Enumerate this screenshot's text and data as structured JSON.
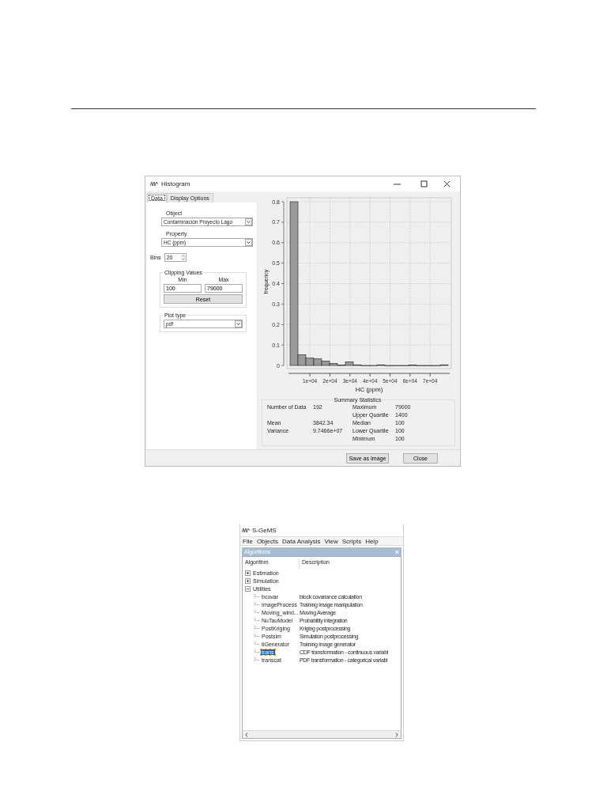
{
  "histogram_window": {
    "title": "Histogram",
    "tabs": [
      {
        "label": "Data",
        "selected": true
      },
      {
        "label": "Display Options",
        "selected": false
      }
    ],
    "object": {
      "label": "Object",
      "value": "Contaminación Proyecto Lago"
    },
    "property": {
      "label": "Property",
      "value": "HC (ppm)"
    },
    "bins": {
      "label": "Bins",
      "value": "20"
    },
    "clipping": {
      "title": "Clipping Values",
      "min_label": "Min",
      "min_value": "100",
      "max_label": "Max",
      "max_value": "79000",
      "reset_button": "Reset"
    },
    "plot_type": {
      "title": "Plot type",
      "value": "pdf"
    },
    "chart_data": {
      "type": "bar",
      "grid": true,
      "xlabel": "HC (ppm)",
      "ylabel": "frequency",
      "x": [
        2073,
        6018,
        9963,
        13908,
        17853,
        21798,
        25743,
        29688,
        33633,
        37578,
        41523,
        45468,
        49413,
        53358,
        57303,
        61248,
        65193,
        69138,
        73083,
        77028
      ],
      "values": [
        0.8,
        0.052,
        0.036,
        0.032,
        0.022,
        0.01,
        0.002,
        0.018,
        0.003,
        0,
        0,
        0.003,
        0,
        0,
        0,
        0.002,
        0,
        0,
        0,
        0.003
      ],
      "xlim": [
        100,
        79000
      ],
      "ylim": [
        0,
        0.8
      ],
      "xticks": [
        {
          "value": 10000,
          "label": "1e+04"
        },
        {
          "value": 20000,
          "label": "2e+04"
        },
        {
          "value": 30000,
          "label": "3e+04"
        },
        {
          "value": 40000,
          "label": "4e+04"
        },
        {
          "value": 50000,
          "label": "5e+04"
        },
        {
          "value": 60000,
          "label": "6e+04"
        },
        {
          "value": 70000,
          "label": "7e+04"
        }
      ],
      "yticks": [
        0,
        0.1,
        0.2,
        0.3,
        0.4,
        0.5,
        0.6,
        0.7,
        0.8
      ]
    },
    "summary": {
      "title": "Summary Statistics",
      "left": [
        {
          "label": "Number of Data",
          "value": "192"
        },
        {
          "label": "Mean",
          "value": "3842.34"
        },
        {
          "label": "Variance",
          "value": "9.7466e+07"
        }
      ],
      "right": [
        {
          "label": "Maximum",
          "value": "79000"
        },
        {
          "label": "Upper Quartile",
          "value": "1400"
        },
        {
          "label": "Median",
          "value": "100"
        },
        {
          "label": "Lower Quartile",
          "value": "100"
        },
        {
          "label": "Minimum",
          "value": "100"
        }
      ]
    },
    "buttons": [
      "Save as Image",
      "Close"
    ]
  },
  "sgems_window": {
    "title": "S-GeMS",
    "menu": [
      "File",
      "Objects",
      "Data Analysis",
      "View",
      "Scripts",
      "Help"
    ],
    "panel": {
      "title": "Algorithms",
      "close": "×",
      "columns": [
        "Algorithm",
        "Description"
      ],
      "tree": [
        {
          "name": "Estimation",
          "expanded": false,
          "selected": false
        },
        {
          "name": "Simulation",
          "expanded": false,
          "selected": false
        },
        {
          "name": "Utilities",
          "expanded": true,
          "selected": false,
          "children": [
            {
              "name": "bcovar",
              "description": "block covariance calculation",
              "selected": false
            },
            {
              "name": "ImageProcess",
              "description": "Training image manipulation",
              "selected": false
            },
            {
              "name": "Moving_wind...",
              "description": "Moving Average",
              "selected": false
            },
            {
              "name": "NuTauModel",
              "description": "Probability integration",
              "selected": false
            },
            {
              "name": "PostKriging",
              "description": "Kriging postprocessing",
              "selected": false
            },
            {
              "name": "Postsim",
              "description": "Simulation postprocessing",
              "selected": false
            },
            {
              "name": "tiGenerator",
              "description": "Training image generator",
              "selected": false
            },
            {
              "name": "trans",
              "description": "CDF transformation - continuous variabl",
              "selected": true
            },
            {
              "name": "transcat",
              "description": "PDF transformation - categorical variabl",
              "selected": false
            }
          ]
        }
      ]
    }
  }
}
